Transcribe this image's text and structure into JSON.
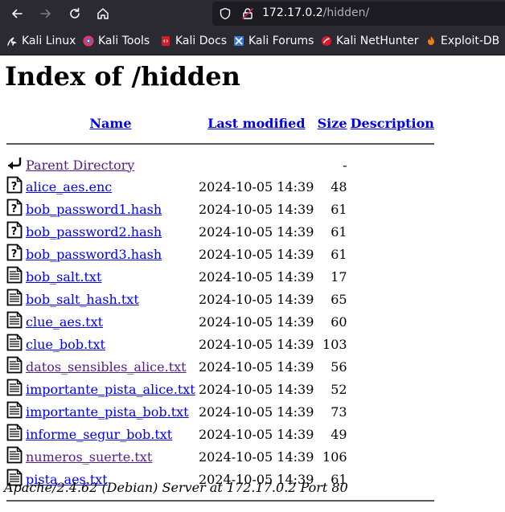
{
  "browser": {
    "url_host": "172.17.0.2",
    "url_path": "/hidden/",
    "bookmarks": [
      {
        "label": "Kali Linux",
        "icon": "kali-dragon-icon"
      },
      {
        "label": "Kali Tools",
        "icon": "kali-tools-icon"
      },
      {
        "label": "Kali Docs",
        "icon": "kali-docs-icon"
      },
      {
        "label": "Kali Forums",
        "icon": "kali-forums-icon"
      },
      {
        "label": "Kali NetHunter",
        "icon": "kali-nethunter-icon"
      },
      {
        "label": "Exploit-DB",
        "icon": "exploit-db-icon"
      }
    ]
  },
  "page": {
    "title": "Index of /hidden",
    "headers": {
      "name": "Name",
      "last_modified": "Last modified",
      "size": "Size",
      "description": "Description"
    },
    "parent": {
      "name": "Parent Directory",
      "size": "-"
    },
    "files": [
      {
        "name": "alice_aes.enc",
        "modified": "2024-10-05 14:39",
        "size": "48",
        "type": "unknown",
        "visited": false
      },
      {
        "name": "bob_password1.hash",
        "modified": "2024-10-05 14:39",
        "size": "61",
        "type": "unknown",
        "visited": false
      },
      {
        "name": "bob_password2.hash",
        "modified": "2024-10-05 14:39",
        "size": "61",
        "type": "unknown",
        "visited": false
      },
      {
        "name": "bob_password3.hash",
        "modified": "2024-10-05 14:39",
        "size": "61",
        "type": "unknown",
        "visited": false
      },
      {
        "name": "bob_salt.txt",
        "modified": "2024-10-05 14:39",
        "size": "17",
        "type": "text",
        "visited": false
      },
      {
        "name": "bob_salt_hash.txt",
        "modified": "2024-10-05 14:39",
        "size": "65",
        "type": "text",
        "visited": false
      },
      {
        "name": "clue_aes.txt",
        "modified": "2024-10-05 14:39",
        "size": "60",
        "type": "text",
        "visited": false
      },
      {
        "name": "clue_bob.txt",
        "modified": "2024-10-05 14:39",
        "size": "103",
        "type": "text",
        "visited": false
      },
      {
        "name": "datos_sensibles_alice.txt",
        "modified": "2024-10-05 14:39",
        "size": "56",
        "type": "text",
        "visited": true
      },
      {
        "name": "importante_pista_alice.txt",
        "modified": "2024-10-05 14:39",
        "size": "52",
        "type": "text",
        "visited": false
      },
      {
        "name": "importante_pista_bob.txt",
        "modified": "2024-10-05 14:39",
        "size": "73",
        "type": "text",
        "visited": false
      },
      {
        "name": "informe_segur_bob.txt",
        "modified": "2024-10-05 14:39",
        "size": "49",
        "type": "text",
        "visited": false
      },
      {
        "name": "numeros_suerte.txt",
        "modified": "2024-10-05 14:39",
        "size": "106",
        "type": "text",
        "visited": true
      },
      {
        "name": "pista_aes.txt",
        "modified": "2024-10-05 14:39",
        "size": "61",
        "type": "text",
        "visited": false
      }
    ],
    "footer": "Apache/2.4.62 (Debian) Server at 172.17.0.2 Port 80"
  },
  "colors": {
    "link": "#0000ee",
    "visited": "#551a8b",
    "chrome_bg": "#2b2a33",
    "urlbar_bg": "#1c1b22"
  }
}
